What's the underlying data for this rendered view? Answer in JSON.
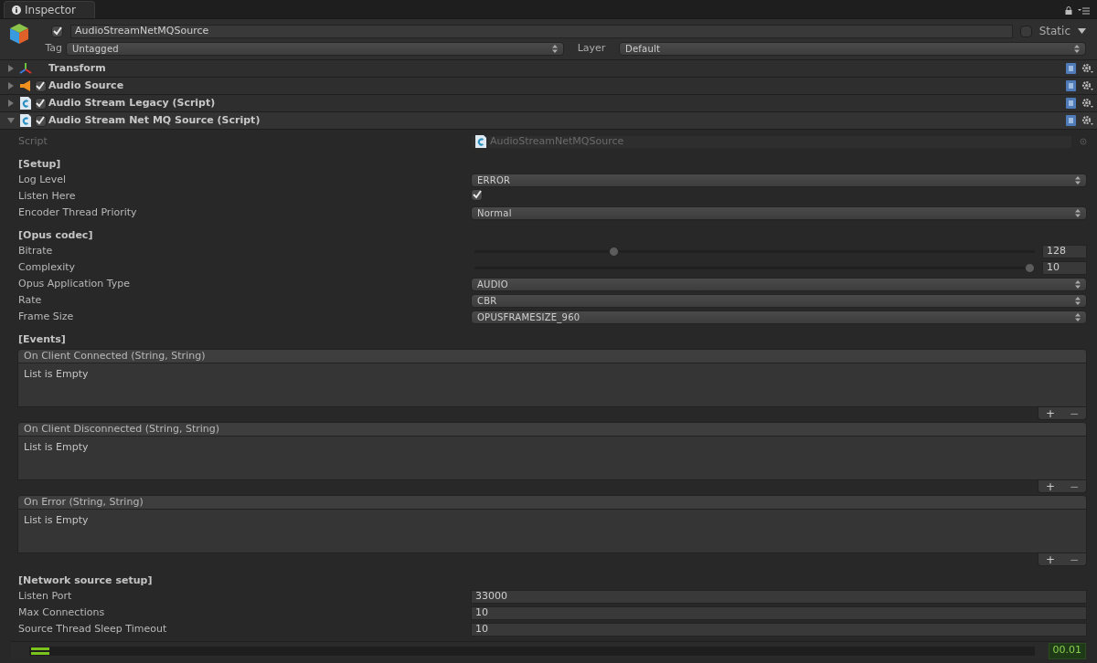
{
  "tab": {
    "title": "Inspector"
  },
  "object": {
    "active": true,
    "name": "AudioStreamNetMQSource",
    "static": false,
    "static_label": "Static",
    "tag_label": "Tag",
    "tag": "Untagged",
    "layer_label": "Layer",
    "layer": "Default"
  },
  "components": [
    {
      "kind": "transform",
      "title": "Transform",
      "expanded": false
    },
    {
      "kind": "audio",
      "title": "Audio Source",
      "expanded": false,
      "enabled": true
    },
    {
      "kind": "script",
      "title": "Audio Stream Legacy (Script)",
      "expanded": false,
      "enabled": true
    },
    {
      "kind": "script",
      "title": "Audio Stream Net MQ Source (Script)",
      "expanded": true,
      "enabled": true
    }
  ],
  "fields": [
    {
      "kind": "object",
      "label": "Script",
      "value": "AudioStreamNetMQSource",
      "disabled": true
    },
    {
      "kind": "section",
      "label": "[Setup]"
    },
    {
      "kind": "dropdown",
      "label": "Log Level",
      "value": "ERROR"
    },
    {
      "kind": "checkbox",
      "label": "Listen Here",
      "checked": true
    },
    {
      "kind": "dropdown",
      "label": "Encoder Thread Priority",
      "value": "Normal"
    },
    {
      "kind": "section",
      "label": "[Opus codec]"
    },
    {
      "kind": "slider",
      "label": "Bitrate",
      "level": 0.245,
      "value": "128"
    },
    {
      "kind": "slider",
      "label": "Complexity",
      "level": 1,
      "value": "10"
    },
    {
      "kind": "dropdown",
      "label": "Opus Application Type",
      "value": "AUDIO"
    },
    {
      "kind": "dropdown",
      "label": "Rate",
      "value": "CBR"
    },
    {
      "kind": "dropdown",
      "label": "Frame Size",
      "value": "OPUSFRAMESIZE_960"
    },
    {
      "kind": "section",
      "label": "[Events]"
    },
    {
      "kind": "event",
      "label": "On Client Connected (String, String)",
      "empty": "List is Empty",
      "add": "+",
      "remove": "−"
    },
    {
      "kind": "event",
      "label": "On Client Disconnected (String, String)",
      "empty": "List is Empty",
      "add": "+",
      "remove": "−"
    },
    {
      "kind": "event",
      "label": "On Error (String, String)",
      "empty": "List is Empty",
      "add": "+",
      "remove": "−"
    },
    {
      "kind": "section",
      "label": "[Network source setup]"
    },
    {
      "kind": "int",
      "label": "Listen Port",
      "value": "33000"
    },
    {
      "kind": "int",
      "label": "Max Connections",
      "value": "10"
    },
    {
      "kind": "int",
      "label": "Source Thread Sleep Timeout",
      "value": "10"
    }
  ],
  "meter": {
    "reading": "00.01"
  }
}
